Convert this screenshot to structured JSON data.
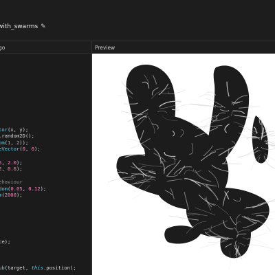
{
  "sketch": {
    "title": "with_swarms",
    "edit_icon": "pencil-icon"
  },
  "panels": {
    "code_label": "go",
    "preview_label": "Preview"
  },
  "code": {
    "lines": [
      [],
      [],
      [],
      [],
      [],
      [],
      [],
      [],
      [],
      [],
      [],
      [
        {
          "t": "tor",
          "c": "fn"
        },
        {
          "t": "(x, y);",
          "c": ""
        }
      ],
      [
        {
          "t": ".random2D();",
          "c": ""
        }
      ],
      [
        {
          "t": "om",
          "c": "fn"
        },
        {
          "t": "(",
          "c": ""
        },
        {
          "t": "1",
          "c": "num"
        },
        {
          "t": ", ",
          "c": ""
        },
        {
          "t": "2",
          "c": "num"
        },
        {
          "t": "));",
          "c": ""
        }
      ],
      [
        {
          "t": "eVector",
          "c": "fn"
        },
        {
          "t": "(",
          "c": ""
        },
        {
          "t": "0",
          "c": "num"
        },
        {
          "t": ", ",
          "c": ""
        },
        {
          "t": "0",
          "c": "num"
        },
        {
          "t": ");",
          "c": ""
        }
      ],
      [],
      [
        {
          "t": "5",
          "c": "num"
        },
        {
          "t": ", ",
          "c": ""
        },
        {
          "t": "2.0",
          "c": "num"
        },
        {
          "t": ");",
          "c": ""
        }
      ],
      [
        {
          "t": "2",
          "c": "num"
        },
        {
          "t": ", ",
          "c": ""
        },
        {
          "t": "0.6",
          "c": "num"
        },
        {
          "t": ");",
          "c": ""
        }
      ],
      [],
      [
        {
          "t": "ehaviour",
          "c": "cm"
        }
      ],
      [
        {
          "t": "dom",
          "c": "fn"
        },
        {
          "t": "(",
          "c": ""
        },
        {
          "t": "0.05",
          "c": "num"
        },
        {
          "t": ", ",
          "c": ""
        },
        {
          "t": "0.12",
          "c": "num"
        },
        {
          "t": ");",
          "c": ""
        }
      ],
      [
        {
          "t": "m",
          "c": "fn"
        },
        {
          "t": "(",
          "c": ""
        },
        {
          "t": "2000",
          "c": "num"
        },
        {
          "t": ");",
          "c": ""
        }
      ],
      [],
      [],
      [],
      [],
      [],
      [],
      [
        {
          "t": "ce);",
          "c": ""
        }
      ],
      [],
      [],
      [],
      [
        {
          "t": "ub",
          "c": "fn"
        },
        {
          "t": "(target, ",
          "c": ""
        },
        {
          "t": "this",
          "c": "kw"
        },
        {
          "t": ".position);",
          "c": ""
        }
      ]
    ]
  },
  "colors": {
    "fn": "#5fd1f2",
    "num": "#f08bbb",
    "kw": "#5fd1f2",
    "comment": "#8a8a8a",
    "preview_bg": "#ffffff",
    "stroke_dark": "#1c1c1c",
    "stroke_light": "#d9d9d9"
  }
}
